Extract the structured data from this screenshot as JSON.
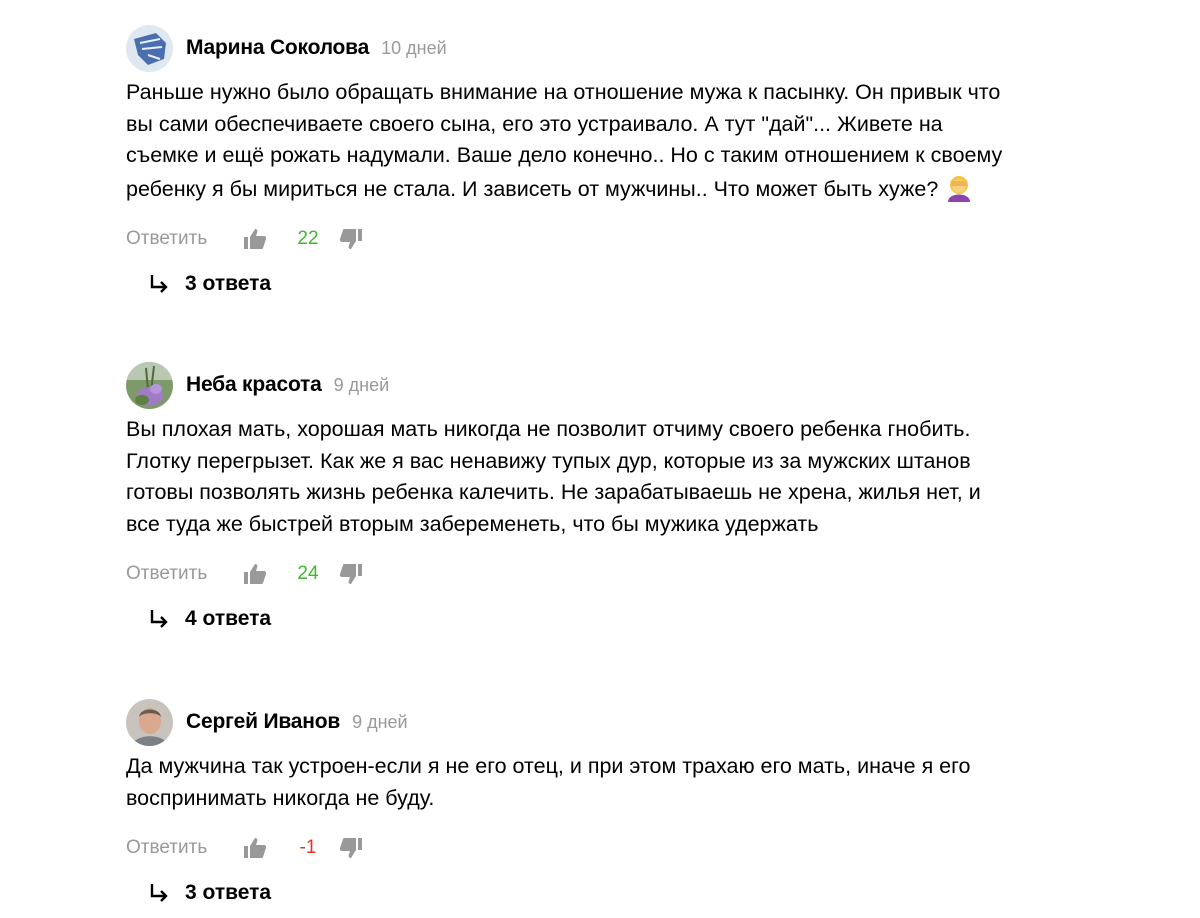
{
  "comments": [
    {
      "author": "Марина Соколова",
      "date": "10 дней",
      "text": "Раньше нужно было обращать внимание на отношение мужа к пасынку. Он привык что вы сами обеспечиваете своего сына, его это устраивало. А тут \"дай\"... Живете на съемке и ещё рожать надумали. Ваше дело конечно.. Но с таким отношением к своему ребенку я бы мириться не стала. И зависеть от мужчины.. Что может быть хуже?",
      "emoji": "woman-facepalming-icon",
      "reply_label": "Ответить",
      "score": "22",
      "replies_label": "3 ответа"
    },
    {
      "author": "Неба красота",
      "date": "9 дней",
      "text": "Вы плохая мать, хорошая мать никогда не позволит отчиму своего ребенка гнобить. Глотку перегрызет. Как же я вас ненавижу тупых дур, которые из за мужских штанов готовы позволять жизнь ребенка калечить. Не зарабатываешь не хрена, жилья нет, и все туда же быстрей вторым забеременеть, что бы мужика удержать",
      "reply_label": "Ответить",
      "score": "24",
      "replies_label": "4 ответа"
    },
    {
      "author": "Сергей Иванов",
      "date": "9 дней",
      "text": "Да мужчина так устроен-если я не его отец, и при этом трахаю его мать, иначе я его воспринимать никогда не буду.",
      "reply_label": "Ответить",
      "score": "-1",
      "replies_label": "3 ответа"
    }
  ],
  "colors": {
    "positive_score": "#3fb82e",
    "negative_score": "#e53323",
    "muted": "#999999"
  }
}
